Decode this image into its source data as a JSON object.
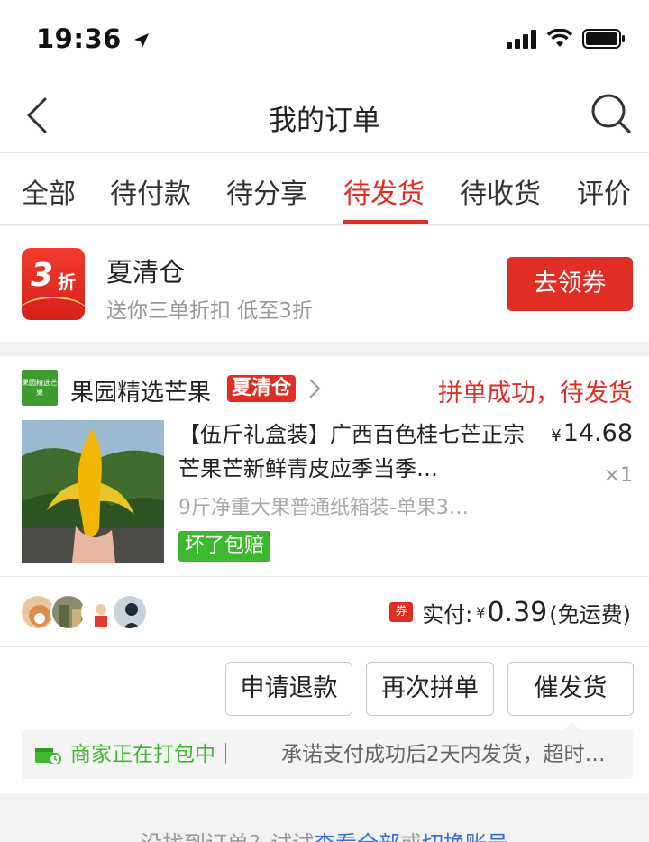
{
  "status_bar": {
    "time": "19:36"
  },
  "nav": {
    "title": "我的订单"
  },
  "tabs": [
    {
      "label": "全部"
    },
    {
      "label": "待付款"
    },
    {
      "label": "待分享"
    },
    {
      "label": "待发货",
      "active": true
    },
    {
      "label": "待收货"
    },
    {
      "label": "评价"
    }
  ],
  "promo": {
    "badge_number": "3",
    "badge_unit": "折",
    "title": "夏清仓",
    "subtitle": "送你三单折扣 低至3折",
    "button_label": "去领券"
  },
  "order": {
    "store_logo_text": "果园精选芒果",
    "store_name": "果园精选芒果",
    "store_tag": "夏清仓",
    "status": "拼单成功，待发货",
    "product_title": "【伍斤礼盒装】广西百色桂七芒正宗芒果芒新鲜青皮应季当季…",
    "price_symbol": "¥",
    "price": "14.68",
    "quantity": "×1",
    "spec": "9斤净重大果普通纸箱装-单果3…",
    "guarantee_tag": "坏了包赔",
    "coupon_icon_text": "券",
    "paid_label": "实付:",
    "paid_symbol": "¥",
    "paid_amount": "0.39",
    "shipping_note": "(免运费)",
    "buttons": {
      "refund": "申请退款",
      "regroup": "再次拼单",
      "urge": "催发货"
    },
    "tip_status": "商家正在打包中｜",
    "tip_text": "承诺支付成功后2天内发货，超时…"
  },
  "footer": {
    "text_prefix": "没找到订单？试试",
    "link_text": "查看全部",
    "text_mid": "或",
    "link_text2": "切换账号"
  },
  "colors": {
    "accent_red": "#e02e24",
    "green": "#3cb92e",
    "link_blue": "#3a6fd8"
  },
  "icons": [
    "location-arrow-icon",
    "signal-icon",
    "wifi-icon",
    "battery-icon",
    "back-chevron-icon",
    "search-icon",
    "chevron-right-icon",
    "package-box-icon",
    "coupon-icon"
  ]
}
